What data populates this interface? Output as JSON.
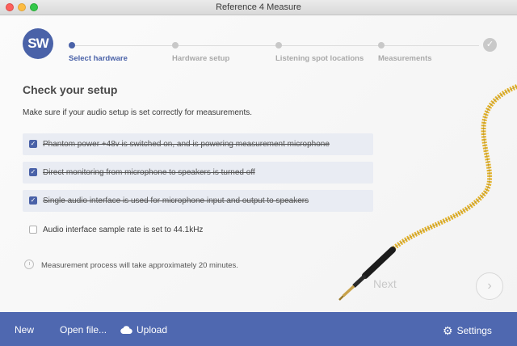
{
  "window": {
    "title": "Reference 4 Measure"
  },
  "logo": {
    "text": "SW"
  },
  "steps": [
    {
      "label": "Select hardware",
      "active": true
    },
    {
      "label": "Hardware setup",
      "active": false
    },
    {
      "label": "Listening spot locations",
      "active": false
    },
    {
      "label": "Measurements",
      "active": false
    }
  ],
  "main": {
    "heading": "Check your setup",
    "subtext": "Make sure if your audio setup is set correctly for measurements.",
    "checks": [
      {
        "label": "Phantom power +48v is switched on, and is powering measurement microphone",
        "checked": true
      },
      {
        "label": "Direct monitoring from microphone to speakers is turned off",
        "checked": true
      },
      {
        "label": "Single audio interface is used for microphone input and output to speakers",
        "checked": true
      },
      {
        "label": "Audio interface sample rate is set to 44.1kHz",
        "checked": false
      }
    ],
    "time_note": "Measurement process will take approximately 20 minutes.",
    "next_label": "Next",
    "next_arrow": "›"
  },
  "footer": {
    "new_label": "New",
    "open_label": "Open file...",
    "upload_label": "Upload",
    "settings_label": "Settings"
  },
  "colors": {
    "accent": "#4a62a8",
    "footer": "#4f68b0",
    "cable": "#e2b128"
  }
}
